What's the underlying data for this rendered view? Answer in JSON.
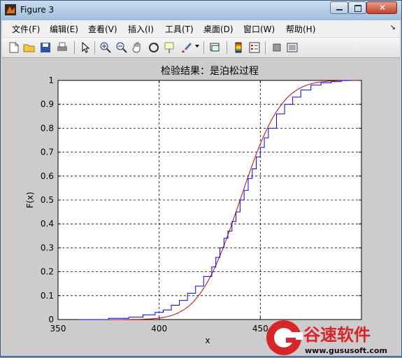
{
  "window": {
    "title": "Figure 3"
  },
  "menu": [
    "文件(F)",
    "编辑(E)",
    "查看(V)",
    "插入(I)",
    "工具(T)",
    "桌面(D)",
    "窗口(W)",
    "帮助(H)"
  ],
  "toolbar": [
    "new-figure-icon",
    "open-icon",
    "save-icon",
    "print-icon",
    "pointer-icon",
    "zoom-in-icon",
    "zoom-out-icon",
    "pan-icon",
    "rotate-icon",
    "data-cursor-icon",
    "brush-icon",
    "link-icon",
    "colorbar-icon",
    "legend-icon",
    "hide-tools-icon",
    "show-tools-icon"
  ],
  "chart_data": {
    "type": "line",
    "title": "检验结果：是泊松过程",
    "xlabel": "x",
    "ylabel": "F(x)",
    "xlim": [
      350,
      500
    ],
    "ylim": [
      0,
      1
    ],
    "xticks": [
      "350",
      "400",
      "450"
    ],
    "yticks": [
      "0",
      "0.1",
      "0.2",
      "0.3",
      "0.4",
      "0.5",
      "0.6",
      "0.7",
      "0.8",
      "0.9",
      "1"
    ],
    "grid": true,
    "series": [
      {
        "style": "stairs",
        "color": "#0000ff",
        "x": [
          360,
          375,
          385,
          392,
          398,
          402,
          406,
          410,
          414,
          418,
          422,
          426,
          428,
          430,
          432,
          434,
          436,
          438,
          440,
          442,
          444,
          446,
          448,
          450,
          452,
          454,
          458,
          462,
          466,
          470,
          475,
          480,
          485,
          490,
          495
        ],
        "y": [
          0.0,
          0.005,
          0.01,
          0.02,
          0.03,
          0.04,
          0.06,
          0.08,
          0.11,
          0.14,
          0.18,
          0.22,
          0.26,
          0.3,
          0.34,
          0.37,
          0.41,
          0.45,
          0.5,
          0.54,
          0.59,
          0.63,
          0.68,
          0.72,
          0.76,
          0.8,
          0.86,
          0.9,
          0.93,
          0.96,
          0.98,
          0.99,
          0.995,
          1.0,
          1.0
        ]
      },
      {
        "style": "smooth",
        "color": "#cc0000",
        "mu": 440,
        "sigma": 16
      }
    ]
  },
  "watermark": {
    "brand": "谷速软件",
    "url": "www.gususoft.com"
  }
}
